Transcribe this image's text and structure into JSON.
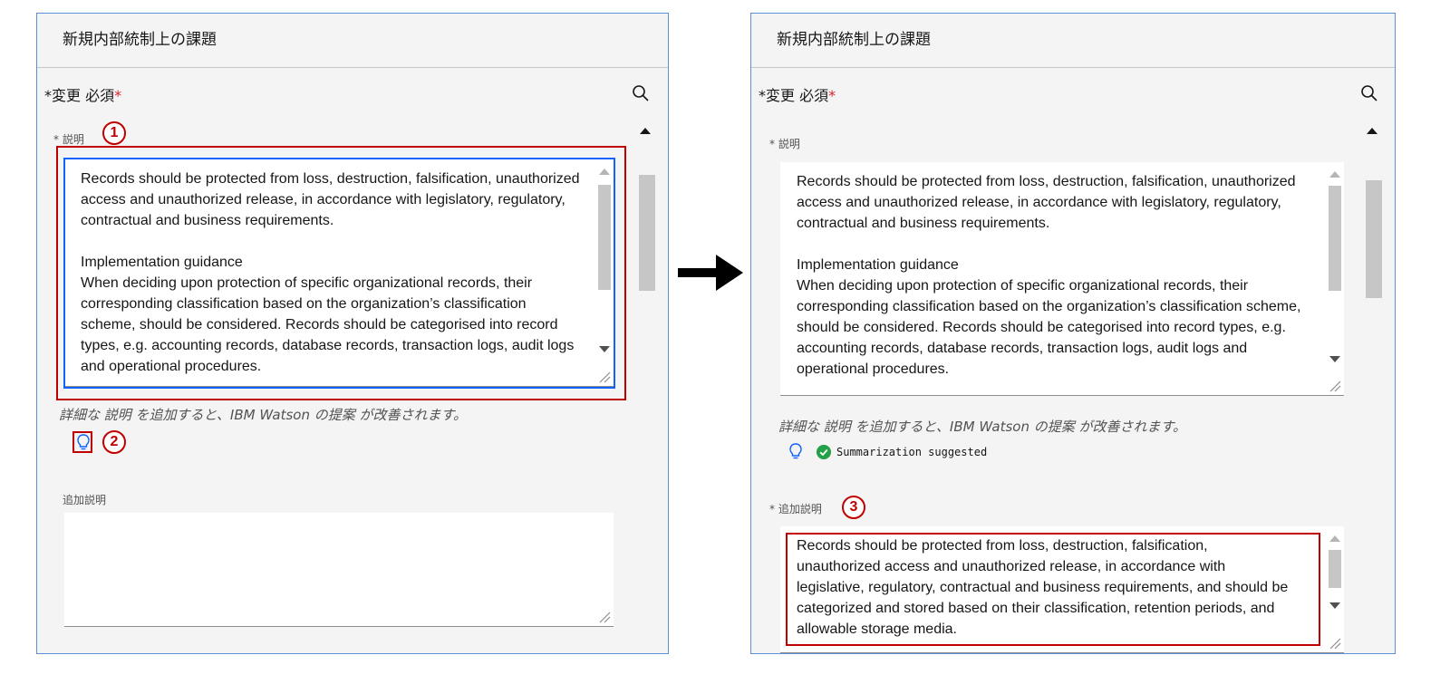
{
  "left_panel": {
    "title": "新規内部統制上の課題",
    "required_prefix": "*",
    "required_label": "変更  必須",
    "required_star": "*",
    "description": {
      "label": "* 説明",
      "badge": "1",
      "paragraph1": "Records should be protected from loss, destruction, falsification, unauthorized access and unauthorized release, in accordance with legislatory, regulatory, contractual and business requirements.",
      "guidance_title": "Implementation guidance",
      "paragraph2": "When deciding upon protection of specific organizational records, their corresponding classification based on the organization’s classification scheme, should be considered. Records should be categorised into record types, e.g. accounting records, database records, transaction logs, audit logs and operational procedures."
    },
    "helper_text": "詳細な 説明 を追加すると、IBM Watson の提案 が改善されます。",
    "bulb_badge": "2",
    "additional": {
      "label": "追加説明",
      "value": ""
    }
  },
  "right_panel": {
    "title": "新規内部統制上の課題",
    "required_prefix": "*",
    "required_label": "変更  必須",
    "required_star": "*",
    "description": {
      "label": "* 説明",
      "paragraph1": "Records should be protected from loss, destruction, falsification, unauthorized access and unauthorized release, in accordance with legislatory, regulatory, contractual and business requirements.",
      "guidance_title": "Implementation guidance",
      "paragraph2": "When deciding upon protection of specific organizational records, their corresponding classification based on the organization’s classification scheme, should be considered. Records should be categorised into record types, e.g. accounting records, database records, transaction logs, audit logs and operational procedures."
    },
    "helper_text": "詳細な 説明 を追加すると、IBM Watson の提案 が改善されます。",
    "status_text": "Summarization suggested",
    "additional": {
      "label": "* 追加説明",
      "badge": "3",
      "value": "Records should be protected from loss, destruction, falsification, unauthorized access and unauthorized release, in accordance with legislative, regulatory, contractual and business requirements, and should be categorized and stored based on their classification, retention periods, and allowable storage media."
    }
  },
  "colors": {
    "annotation_red": "#c00000",
    "focus_blue": "#0f62fe",
    "required_red": "#da1e28",
    "success_green": "#24a148",
    "panel_border": "#5b8fd6"
  },
  "icons": [
    "search-icon",
    "lightbulb-icon",
    "checkmark-icon",
    "arrow-right-icon",
    "resize-grip-icon"
  ]
}
